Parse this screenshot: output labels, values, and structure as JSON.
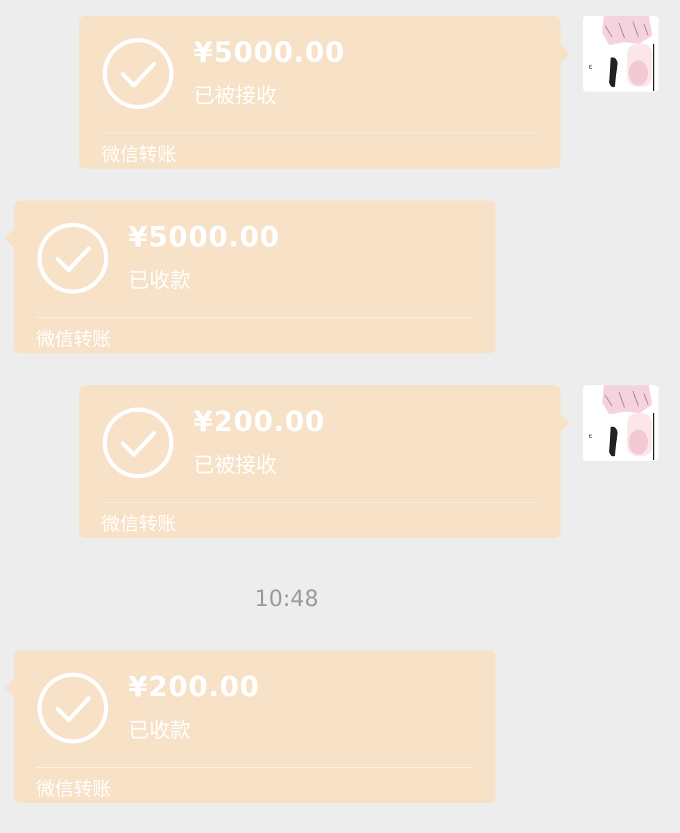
{
  "messages": [
    {
      "direction": "sent",
      "amount": "¥5000.00",
      "status": "已被接收",
      "footer": "微信转账"
    },
    {
      "direction": "received",
      "amount": "¥5000.00",
      "status": "已收款",
      "footer": "微信转账"
    },
    {
      "direction": "sent",
      "amount": "¥200.00",
      "status": "已被接收",
      "footer": "微信转账"
    },
    {
      "direction": "received",
      "amount": "¥200.00",
      "status": "已收款",
      "footer": "微信转账"
    }
  ],
  "timestamp": "10:48",
  "colors": {
    "background": "#ededed",
    "bubble": "#f7e1c7",
    "text": "#ffffff",
    "timestamp": "#9c9c9c"
  },
  "icons": {
    "check": "check-circle-icon",
    "avatar": "user-avatar"
  }
}
